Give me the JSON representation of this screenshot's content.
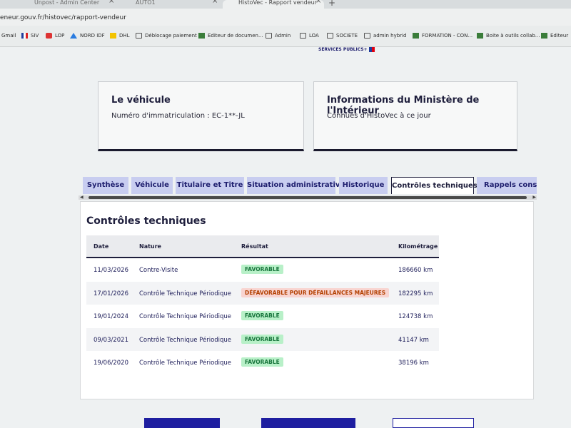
{
  "browser": {
    "tabs": [
      {
        "label": "Unpost - Admin Center"
      },
      {
        "label": "AUTO1"
      },
      {
        "label": "HistoVec - Rapport vendeur"
      }
    ],
    "url": "eneur.gouv.fr/histovec/rapport-vendeur",
    "bookmarks": [
      {
        "label": "Gmail"
      },
      {
        "label": "SIV"
      },
      {
        "label": "LOP"
      },
      {
        "label": "NORD IDF"
      },
      {
        "label": "DHL"
      },
      {
        "label": "Déblocage paiement"
      },
      {
        "label": "Editeur de documen..."
      },
      {
        "label": "Admin"
      },
      {
        "label": "LOA"
      },
      {
        "label": "SOCIETE"
      },
      {
        "label": "admin hybrid"
      },
      {
        "label": "FORMATION - CON..."
      },
      {
        "label": "Boite à outils collab..."
      },
      {
        "label": "Editeur"
      }
    ]
  },
  "header": {
    "logo_text": "SERVICES PUBLICS+"
  },
  "vehicle_card": {
    "title": "Le véhicule",
    "subtitle": "Numéro d'immatriculation : EC-1**-JL"
  },
  "ministry_card": {
    "title": "Informations du Ministère de l'Intérieur",
    "subtitle": "Connues d'HistoVec à ce jour"
  },
  "section_tabs": [
    {
      "label": "Synthèse"
    },
    {
      "label": "Véhicule"
    },
    {
      "label": "Titulaire et Titre"
    },
    {
      "label": "Situation administrative"
    },
    {
      "label": "Historique"
    },
    {
      "label": "Contrôles techniques"
    },
    {
      "label": "Rappels constructeur"
    }
  ],
  "panel": {
    "title": "Contrôles techniques",
    "columns": [
      "Date",
      "Nature",
      "Résultat",
      "Kilométrage"
    ],
    "rows": [
      {
        "date": "11/03/2026",
        "nature": "Contre-Visite",
        "result": "FAVORABLE",
        "km": "186660 km"
      },
      {
        "date": "17/01/2026",
        "nature": "Contrôle Technique Périodique",
        "result": "DÉFAVORABLE POUR DÉFAILLANCES MAJEURES",
        "km": "182295 km"
      },
      {
        "date": "19/01/2024",
        "nature": "Contrôle Technique Périodique",
        "result": "FAVORABLE",
        "km": "124738 km"
      },
      {
        "date": "09/03/2021",
        "nature": "Contrôle Technique Périodique",
        "result": "FAVORABLE",
        "km": "41147 km"
      },
      {
        "date": "19/06/2020",
        "nature": "Contrôle Technique Périodique",
        "result": "FAVORABLE",
        "km": "38196 km"
      }
    ]
  },
  "colors": {
    "accent": "#1e1ea0",
    "ok_bg": "#b8f0c8",
    "ok_fg": "#18753c",
    "ko_bg": "#f8d4d0",
    "ko_fg": "#b34000"
  }
}
